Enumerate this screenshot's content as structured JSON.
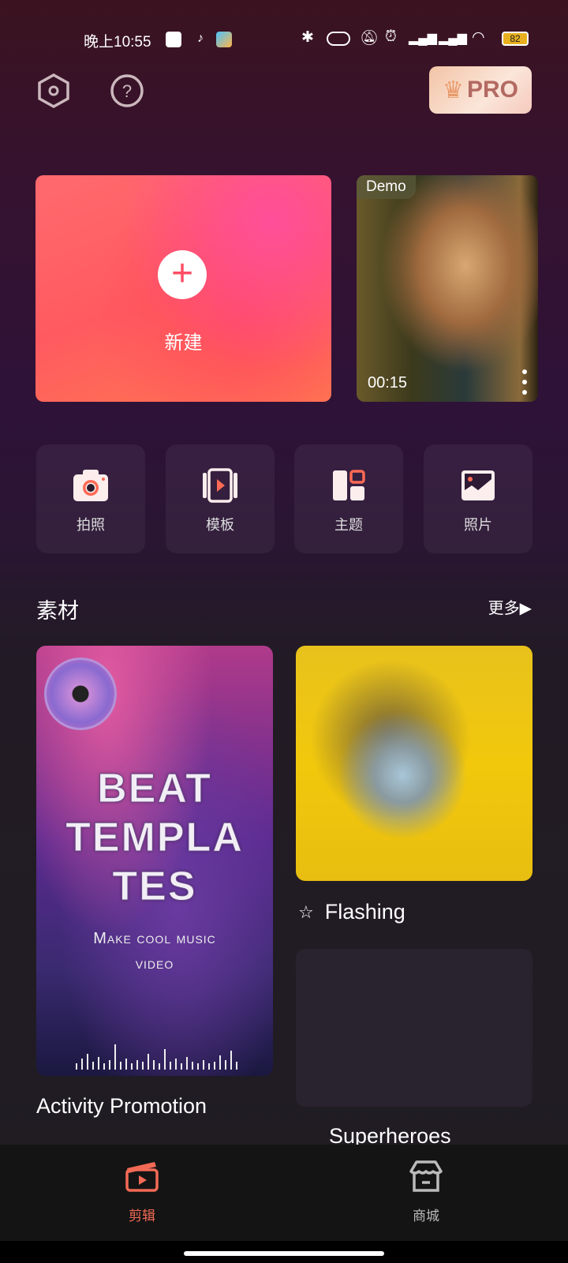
{
  "status_bar": {
    "time": "晚上10:55",
    "battery": "82",
    "icons": [
      "qq-icon",
      "tiktok-icon",
      "app-icon",
      "bluetooth-icon",
      "toggle-icon",
      "mute-icon",
      "alarm-icon",
      "signal-hd-icon",
      "signal-hd-icon",
      "wifi-icon",
      "battery-icon"
    ]
  },
  "header": {
    "pro_label": "PRO",
    "icons": [
      "settings-hexagon-icon",
      "help-icon",
      "crown-icon"
    ]
  },
  "new_project": {
    "label": "新建"
  },
  "demo": {
    "tag": "Demo",
    "duration": "00:15"
  },
  "tools": [
    {
      "label": "拍照",
      "icon": "camera-icon"
    },
    {
      "label": "模板",
      "icon": "template-icon"
    },
    {
      "label": "主题",
      "icon": "theme-icon"
    },
    {
      "label": "照片",
      "icon": "photo-icon"
    }
  ],
  "materials": {
    "title": "素材",
    "more": "更多",
    "items": [
      {
        "title": "Activity Promotion",
        "poster_line1": "BEAT",
        "poster_line2": "TEMPLA",
        "poster_line3": "TES",
        "poster_sub1": "Make cool music",
        "poster_sub2": "video"
      },
      {
        "title": "Flashing",
        "icon": "sparkle-icon"
      },
      {
        "title": "Superheroes"
      }
    ]
  },
  "bottom_nav": {
    "items": [
      {
        "label": "剪辑",
        "icon": "clapperboard-icon",
        "active": true
      },
      {
        "label": "商城",
        "icon": "store-icon",
        "active": false
      }
    ]
  },
  "colors": {
    "accent": "#ff6a50",
    "active_nav": "#f26a55"
  }
}
